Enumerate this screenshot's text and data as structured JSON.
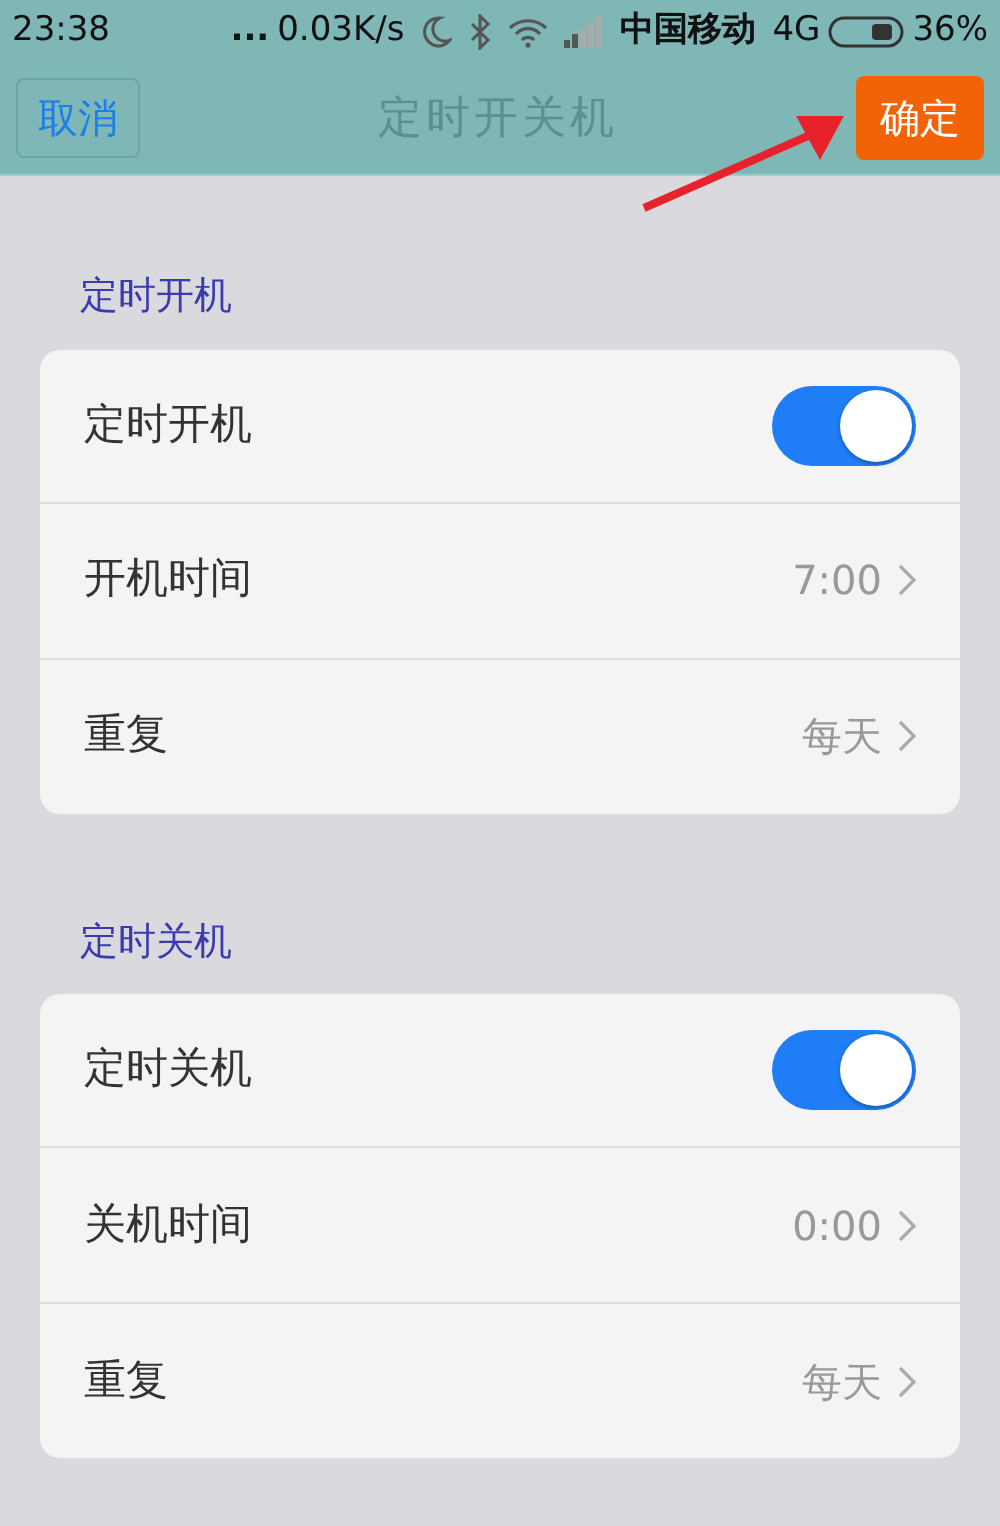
{
  "status_bar": {
    "time": "23:38",
    "dots": "...",
    "speed": "0.03K/s",
    "carrier": "中国移动",
    "network": "4G",
    "battery": "36%"
  },
  "header": {
    "cancel": "取消",
    "title": "定时开关机",
    "confirm": "确定"
  },
  "sections": [
    {
      "title": "定时开机",
      "rows": [
        {
          "kind": "toggle",
          "label": "定时开机",
          "on": true
        },
        {
          "kind": "link",
          "label": "开机时间",
          "value": "7:00"
        },
        {
          "kind": "link",
          "label": "重复",
          "value": "每天"
        }
      ]
    },
    {
      "title": "定时关机",
      "rows": [
        {
          "kind": "toggle",
          "label": "定时关机",
          "on": true
        },
        {
          "kind": "link",
          "label": "关机时间",
          "value": "0:00"
        },
        {
          "kind": "link",
          "label": "重复",
          "value": "每天"
        }
      ]
    }
  ]
}
